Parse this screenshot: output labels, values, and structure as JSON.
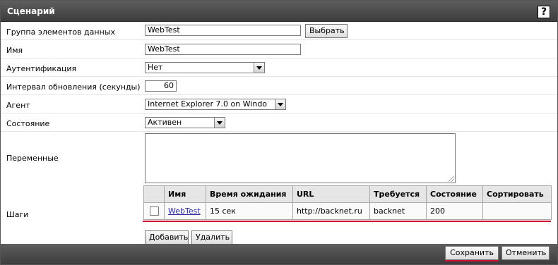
{
  "window": {
    "title": "Сценарий",
    "help_label": "?"
  },
  "fields": {
    "group": {
      "label": "Группа элементов данных",
      "value": "WebTest",
      "button": "Выбрать"
    },
    "name": {
      "label": "Имя",
      "value": "WebTest"
    },
    "auth": {
      "label": "Аутентификация",
      "value": "Нет"
    },
    "interval": {
      "label": "Интервал обновления (секунды)",
      "value": "60"
    },
    "agent": {
      "label": "Агент",
      "value": "Internet Explorer 7.0 on Windo"
    },
    "status": {
      "label": "Состояние",
      "value": "Активен"
    },
    "variables": {
      "label": "Переменные",
      "value": ""
    }
  },
  "steps": {
    "label": "Шаги",
    "columns": [
      "",
      "Имя",
      "Время ожидания",
      "URL",
      "Требуется",
      "Состояние",
      "Сортировать"
    ],
    "rows": [
      {
        "name": "WebTest",
        "timeout": "15 сек",
        "url": "http://backnet.ru",
        "required": "backnet",
        "status": "200",
        "sort": ""
      }
    ],
    "add_button": "Добавить",
    "delete_button": "Удалить"
  },
  "footer": {
    "save_button": "Сохранить",
    "cancel_button": "Отменить"
  },
  "colors": {
    "accent_line": "#c8102e",
    "title_bar": "#4a4a4a"
  }
}
